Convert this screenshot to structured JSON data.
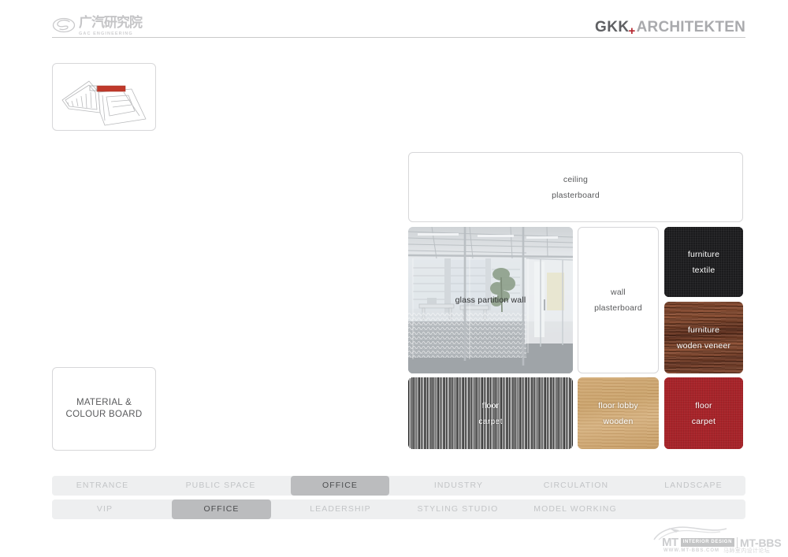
{
  "header": {
    "left_logo": {
      "icon": "gac-oval-logo-icon",
      "cn_name": "广汽研究院",
      "en_name": "GAC ENGINEERING"
    },
    "right_logo": {
      "brand": "GKK",
      "separator": "+",
      "suffix": "ARCHITEKTEN",
      "accent_color": "#b4252c",
      "brand_color": "#5f6063",
      "suffix_color": "#a9aaad"
    }
  },
  "sidebar": {
    "thumbnail": {
      "name": "floor-plan-thumbnail",
      "highlight_color": "#c0392b"
    },
    "title_box": {
      "line1": "MATERIAL &",
      "line2": "COLOUR BOARD"
    }
  },
  "board": {
    "tiles": [
      {
        "id": "ceiling",
        "line1": "ceiling",
        "line2": "plasterboard",
        "style": "plain-white",
        "text_color": "#58595b"
      },
      {
        "id": "glass",
        "line1": "glass partition wall",
        "line2": "",
        "style": "photo-office-glass",
        "text_color": "#2e2f31"
      },
      {
        "id": "wall",
        "line1": "wall",
        "line2": "plasterboard",
        "style": "plain-white",
        "text_color": "#58595b"
      },
      {
        "id": "textile",
        "line1": "furniture",
        "line2": "textile",
        "style": "dark-textile",
        "swatch_color": "#1b1b1d",
        "text_color": "#ffffff"
      },
      {
        "id": "veneer",
        "line1": "furniture",
        "line2": "woden veneer",
        "style": "dark-wood",
        "swatch_color": "#7a3f25",
        "text_color": "#ffffff"
      },
      {
        "id": "carpet-grey",
        "line1": "floor",
        "line2": "carpet",
        "style": "striped-carpet",
        "swatch_color": "#8c8c8c",
        "text_color": "#ffffff"
      },
      {
        "id": "wooden",
        "line1": "floor lobby",
        "line2": "wooden",
        "style": "light-wood",
        "swatch_color": "#c9a068",
        "text_color": "#ffffff"
      },
      {
        "id": "carpet-red",
        "line1": "floor",
        "line2": "carpet",
        "style": "red-carpet",
        "swatch_color": "#a8242a",
        "text_color": "#ffffff"
      }
    ]
  },
  "nav": {
    "row1": [
      {
        "label": "ENTRANCE",
        "active": false
      },
      {
        "label": "PUBLIC SPACE",
        "active": false
      },
      {
        "label": "OFFICE",
        "active": true
      },
      {
        "label": "INDUSTRY",
        "active": false
      },
      {
        "label": "CIRCULATION",
        "active": false
      },
      {
        "label": "LANDSCAPE",
        "active": false
      }
    ],
    "row2": [
      {
        "label": "VIP",
        "active": false
      },
      {
        "label": "OFFICE",
        "active": true
      },
      {
        "label": "LEADERSHIP",
        "active": false
      },
      {
        "label": "STYLING STUDIO",
        "active": false
      },
      {
        "label": "MODEL WORKING",
        "active": false
      }
    ],
    "active_color": "#bbbcbe",
    "track_color": "#eeeff0",
    "inactive_text_color": "#c3c5c7"
  },
  "watermark": {
    "mt": "MT",
    "badge": "INTERIOR DESIGN",
    "bbs": "MT-BBS",
    "url": "WWW.MT-BBS.COM",
    "cn": "马蹄室内设计论坛"
  }
}
